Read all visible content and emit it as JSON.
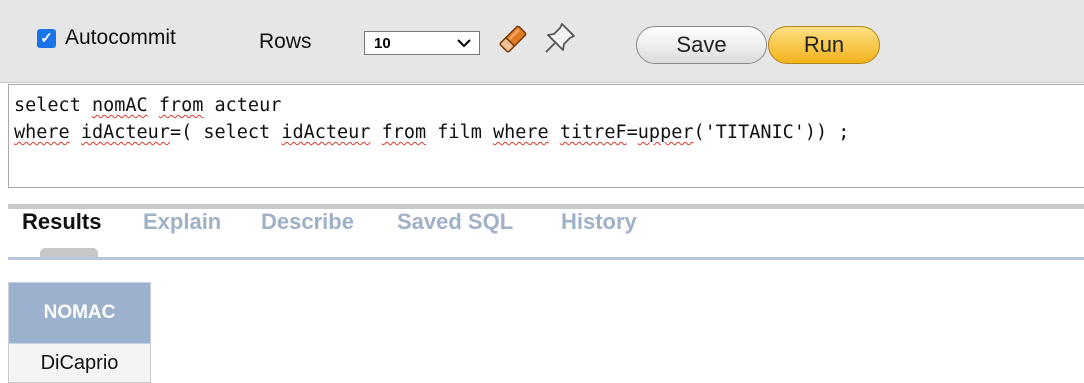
{
  "toolbar": {
    "autocommit": {
      "label": "Autocommit",
      "checked": true
    },
    "rows": {
      "label": "Rows",
      "selected": "10"
    },
    "icons": [
      "eraser-icon",
      "pin-icon"
    ],
    "save_label": "Save",
    "run_label": "Run"
  },
  "editor": {
    "line1": "select nomAC from acteur",
    "line2": "where idActeur=( select idActeur from film where titreF=upper('TITANIC')) ;"
  },
  "tabs": [
    {
      "label": "Results",
      "active": true
    },
    {
      "label": "Explain",
      "active": false
    },
    {
      "label": "Describe",
      "active": false
    },
    {
      "label": "Saved SQL",
      "active": false
    },
    {
      "label": "History",
      "active": false
    }
  ],
  "results": {
    "columns": [
      "NOMAC"
    ],
    "rows": [
      [
        "DiCaprio"
      ]
    ]
  },
  "colors": {
    "run_button": "#f2b21c",
    "table_header": "#9cb1ce",
    "inactive_tab": "#9fb0c9",
    "checkbox": "#1a73e8"
  }
}
